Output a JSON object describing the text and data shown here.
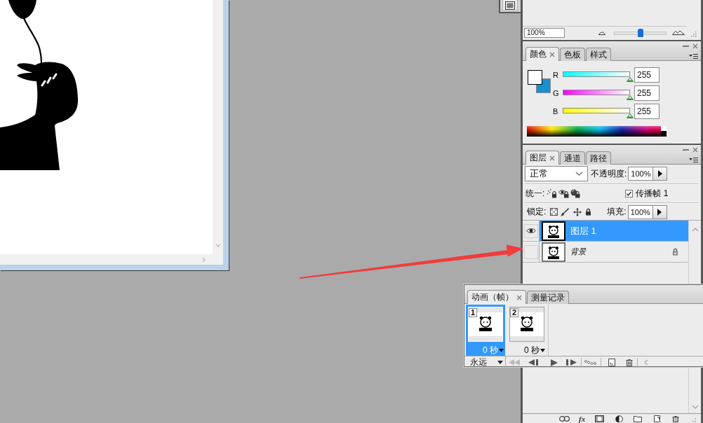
{
  "navigator": {
    "zoom": "100%",
    "zoom_slider": {
      "level": 0.5
    }
  },
  "color_panel": {
    "tabs": [
      {
        "label": "颜色",
        "selected": true
      },
      {
        "label": "色板",
        "selected": false
      },
      {
        "label": "样式",
        "selected": false
      }
    ],
    "swatches": [
      {
        "kind": "foreground",
        "color": "#ffffff"
      },
      {
        "kind": "background",
        "color": "#1a8fd0"
      }
    ],
    "channels": [
      {
        "name": "R",
        "level": 1,
        "value": "255"
      },
      {
        "name": "G",
        "level": 1,
        "value": "255"
      },
      {
        "name": "B",
        "level": 1,
        "value": "255"
      }
    ]
  },
  "layers_panel": {
    "tabs": [
      {
        "label": "图层",
        "selected": true
      },
      {
        "label": "通道",
        "selected": false
      },
      {
        "label": "路径",
        "selected": false
      }
    ],
    "blend_mode": "正常",
    "opacity_label": "不透明度:",
    "opacity": "100%",
    "unify_label": "统一:",
    "propagate": {
      "label": "传播帧 1",
      "checked": true
    },
    "lock_label": "锁定:",
    "fill_label": "填充:",
    "fill": "100%",
    "layers": [
      {
        "kind": "layer",
        "name": "图层 1",
        "visible": true,
        "locked": false,
        "selected": true
      },
      {
        "kind": "background",
        "name": "背景",
        "visible": false,
        "locked": true,
        "selected": false
      }
    ],
    "style_button": "fx"
  },
  "animation_panel": {
    "tabs": [
      {
        "label": "动画（帧）",
        "selected": true
      },
      {
        "label": "测量记录",
        "selected": false
      }
    ],
    "frames": [
      {
        "number": "1",
        "delay": "0 秒",
        "selected": true
      },
      {
        "number": "2",
        "delay": "0 秒",
        "selected": false
      }
    ],
    "loop": "永远"
  }
}
